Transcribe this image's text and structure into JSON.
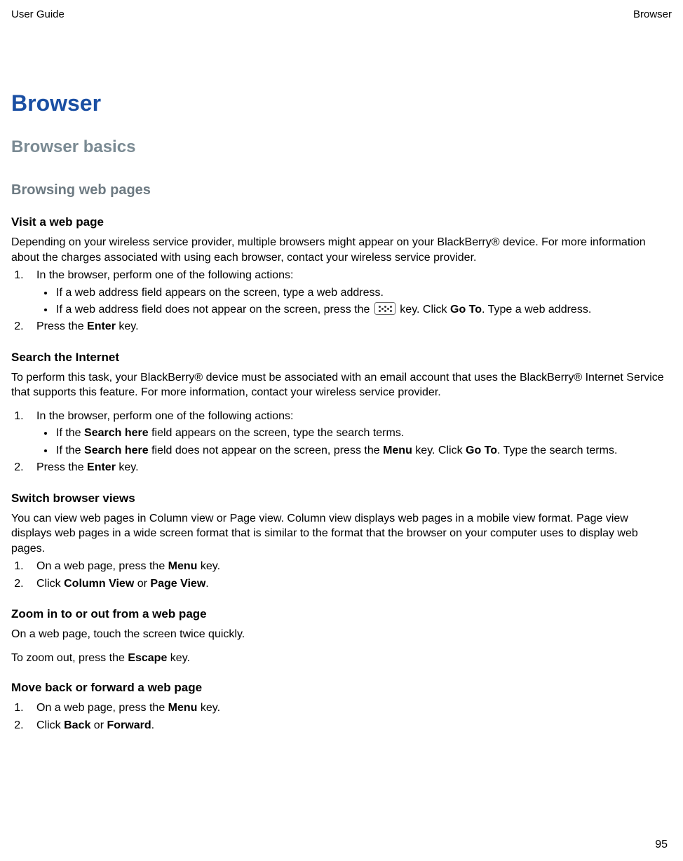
{
  "header": {
    "left": "User Guide",
    "right": "Browser"
  },
  "title": "Browser",
  "subtitle": "Browser basics",
  "section_title": "Browsing web pages",
  "visit": {
    "heading": "Visit a web page",
    "intro": "Depending on your wireless service provider, multiple browsers might appear on your BlackBerry® device. For more information about the charges associated with using each browser, contact your wireless service provider.",
    "step1": "In the browser, perform one of the following actions:",
    "b1": "If a web address field appears on the screen, type a web address.",
    "b2a": "If a web address field does not appear on the screen, press the ",
    "b2b": " key. Click ",
    "b2_go": "Go To",
    "b2c": ". Type a web address.",
    "step2a": "Press the ",
    "step2_enter": "Enter",
    "step2b": " key."
  },
  "search": {
    "heading": "Search the Internet",
    "intro": "To perform this task, your BlackBerry® device must be associated with an email account that uses the BlackBerry® Internet Service that supports this feature. For more information, contact your wireless service provider.",
    "step1": "In the browser, perform one of the following actions:",
    "b1a": "If the ",
    "b1_sh": "Search here",
    "b1b": " field appears on the screen, type the search terms.",
    "b2a": "If the ",
    "b2_sh": "Search here",
    "b2b": " field does not appear on the screen, press the ",
    "b2_menu": "Menu",
    "b2c": " key. Click ",
    "b2_go": "Go To",
    "b2d": ". Type the search terms.",
    "step2a": "Press the ",
    "step2_enter": "Enter",
    "step2b": " key."
  },
  "switch": {
    "heading": "Switch browser views",
    "intro": "You can view web pages in Column view or Page view. Column view displays web pages in a mobile view format. Page view displays web pages in a wide screen format that is similar to the format that the browser on your computer uses to display web pages.",
    "s1a": "On a web page, press the ",
    "s1_menu": "Menu",
    "s1b": " key.",
    "s2a": "Click ",
    "s2_cv": "Column View",
    "s2b": " or ",
    "s2_pv": "Page View",
    "s2c": "."
  },
  "zoom": {
    "heading": "Zoom in to or out from a web page",
    "p1": "On a web page, touch the screen twice quickly.",
    "p2a": "To zoom out, press the ",
    "p2_esc": "Escape",
    "p2b": " key."
  },
  "move": {
    "heading": "Move back or forward a web page",
    "s1a": "On a web page, press the ",
    "s1_menu": "Menu",
    "s1b": " key.",
    "s2a": "Click ",
    "s2_back": "Back",
    "s2b": " or ",
    "s2_fwd": "Forward",
    "s2c": "."
  },
  "page_number": "95"
}
